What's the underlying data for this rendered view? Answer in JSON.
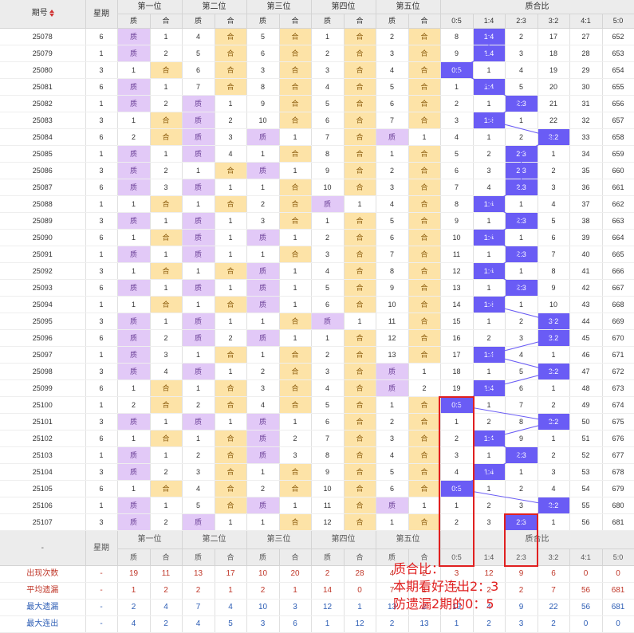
{
  "header": {
    "issue": "期号",
    "week": "星期",
    "positions": [
      "第一位",
      "第二位",
      "第三位",
      "第四位",
      "第五位"
    ],
    "ratio_group": "质合比",
    "sub_zhi": "质",
    "sub_he": "合",
    "ratios": [
      "0:5",
      "1:4",
      "2:3",
      "3:2",
      "4:1",
      "5:0"
    ]
  },
  "colors": {
    "zhi": "#e2c9f7",
    "he": "#fde3a7",
    "hit": "#6a5cf5",
    "annot": "#e02020"
  },
  "rows": [
    {
      "issue": "25078",
      "week": "6",
      "pos": [
        [
          "Z",
          "1"
        ],
        [
          "4",
          "H"
        ],
        [
          "5",
          "H"
        ],
        [
          "1",
          "H"
        ],
        [
          "2",
          "H"
        ]
      ],
      "ratio": [
        "8",
        "1:4",
        "2",
        "17",
        "27",
        "652"
      ],
      "hit": 1
    },
    {
      "issue": "25079",
      "week": "1",
      "pos": [
        [
          "Z",
          "2"
        ],
        [
          "5",
          "H"
        ],
        [
          "6",
          "H"
        ],
        [
          "2",
          "H"
        ],
        [
          "3",
          "H"
        ]
      ],
      "ratio": [
        "9",
        "1:4",
        "3",
        "18",
        "28",
        "653"
      ],
      "hit": 1
    },
    {
      "issue": "25080",
      "week": "3",
      "pos": [
        [
          "1",
          "H"
        ],
        [
          "6",
          "H"
        ],
        [
          "3",
          "H"
        ],
        [
          "3",
          "H"
        ],
        [
          "4",
          "H"
        ]
      ],
      "ratio": [
        "0:5",
        "1",
        "4",
        "19",
        "29",
        "654"
      ],
      "hit": 0
    },
    {
      "issue": "25081",
      "week": "6",
      "pos": [
        [
          "Z",
          "1"
        ],
        [
          "7",
          "H"
        ],
        [
          "8",
          "H"
        ],
        [
          "4",
          "H"
        ],
        [
          "5",
          "H"
        ]
      ],
      "ratio": [
        "1",
        "1:4",
        "5",
        "20",
        "30",
        "655"
      ],
      "hit": 1
    },
    {
      "issue": "25082",
      "week": "1",
      "pos": [
        [
          "Z",
          "2"
        ],
        [
          "Z",
          "1"
        ],
        [
          "9",
          "H"
        ],
        [
          "5",
          "H"
        ],
        [
          "6",
          "H"
        ]
      ],
      "ratio": [
        "2",
        "1",
        "2:3",
        "21",
        "31",
        "656"
      ],
      "hit": 2
    },
    {
      "issue": "25083",
      "week": "3",
      "pos": [
        [
          "1",
          "H"
        ],
        [
          "Z",
          "2"
        ],
        [
          "10",
          "H"
        ],
        [
          "6",
          "H"
        ],
        [
          "7",
          "H"
        ]
      ],
      "ratio": [
        "3",
        "1:4",
        "1",
        "22",
        "32",
        "657"
      ],
      "hit": 1
    },
    {
      "issue": "25084",
      "week": "6",
      "pos": [
        [
          "2",
          "H"
        ],
        [
          "Z",
          "3"
        ],
        [
          "Z",
          "1"
        ],
        [
          "7",
          "H"
        ],
        [
          "Z",
          "1"
        ]
      ],
      "ratio": [
        "4",
        "1",
        "2",
        "3:2",
        "33",
        "658"
      ],
      "hit": 3
    },
    {
      "issue": "25085",
      "week": "1",
      "pos": [
        [
          "Z",
          "1"
        ],
        [
          "Z",
          "4"
        ],
        [
          "1",
          "H"
        ],
        [
          "8",
          "H"
        ],
        [
          "1",
          "H"
        ]
      ],
      "ratio": [
        "5",
        "2",
        "2:3",
        "1",
        "34",
        "659"
      ],
      "hit": 2
    },
    {
      "issue": "25086",
      "week": "3",
      "pos": [
        [
          "Z",
          "2"
        ],
        [
          "1",
          "H"
        ],
        [
          "Z",
          "1"
        ],
        [
          "9",
          "H"
        ],
        [
          "2",
          "H"
        ]
      ],
      "ratio": [
        "6",
        "3",
        "2:3",
        "2",
        "35",
        "660"
      ],
      "hit": 2
    },
    {
      "issue": "25087",
      "week": "6",
      "pos": [
        [
          "Z",
          "3"
        ],
        [
          "Z",
          "1"
        ],
        [
          "1",
          "H"
        ],
        [
          "10",
          "H"
        ],
        [
          "3",
          "H"
        ]
      ],
      "ratio": [
        "7",
        "4",
        "2:3",
        "3",
        "36",
        "661"
      ],
      "hit": 2
    },
    {
      "issue": "25088",
      "week": "1",
      "pos": [
        [
          "1",
          "H"
        ],
        [
          "1",
          "H"
        ],
        [
          "2",
          "H"
        ],
        [
          "Z",
          "1"
        ],
        [
          "4",
          "H"
        ]
      ],
      "ratio": [
        "8",
        "1:4",
        "1",
        "4",
        "37",
        "662"
      ],
      "hit": 1
    },
    {
      "issue": "25089",
      "week": "3",
      "pos": [
        [
          "Z",
          "1"
        ],
        [
          "Z",
          "1"
        ],
        [
          "3",
          "H"
        ],
        [
          "1",
          "H"
        ],
        [
          "5",
          "H"
        ]
      ],
      "ratio": [
        "9",
        "1",
        "2:3",
        "5",
        "38",
        "663"
      ],
      "hit": 2
    },
    {
      "issue": "25090",
      "week": "6",
      "pos": [
        [
          "1",
          "H"
        ],
        [
          "Z",
          "1"
        ],
        [
          "Z",
          "1"
        ],
        [
          "2",
          "H"
        ],
        [
          "6",
          "H"
        ]
      ],
      "ratio": [
        "10",
        "1:4",
        "1",
        "6",
        "39",
        "664"
      ],
      "hit": 1
    },
    {
      "issue": "25091",
      "week": "1",
      "pos": [
        [
          "Z",
          "1"
        ],
        [
          "Z",
          "1"
        ],
        [
          "1",
          "H"
        ],
        [
          "3",
          "H"
        ],
        [
          "7",
          "H"
        ]
      ],
      "ratio": [
        "11",
        "1",
        "2:3",
        "7",
        "40",
        "665"
      ],
      "hit": 2
    },
    {
      "issue": "25092",
      "week": "3",
      "pos": [
        [
          "1",
          "H"
        ],
        [
          "1",
          "H"
        ],
        [
          "Z",
          "1"
        ],
        [
          "4",
          "H"
        ],
        [
          "8",
          "H"
        ]
      ],
      "ratio": [
        "12",
        "1:4",
        "1",
        "8",
        "41",
        "666"
      ],
      "hit": 1
    },
    {
      "issue": "25093",
      "week": "6",
      "pos": [
        [
          "Z",
          "1"
        ],
        [
          "Z",
          "1"
        ],
        [
          "Z",
          "1"
        ],
        [
          "5",
          "H"
        ],
        [
          "9",
          "H"
        ]
      ],
      "ratio": [
        "13",
        "1",
        "2:3",
        "9",
        "42",
        "667"
      ],
      "hit": 2
    },
    {
      "issue": "25094",
      "week": "1",
      "pos": [
        [
          "1",
          "H"
        ],
        [
          "1",
          "H"
        ],
        [
          "Z",
          "1"
        ],
        [
          "6",
          "H"
        ],
        [
          "10",
          "H"
        ]
      ],
      "ratio": [
        "14",
        "1:4",
        "1",
        "10",
        "43",
        "668"
      ],
      "hit": 1
    },
    {
      "issue": "25095",
      "week": "3",
      "pos": [
        [
          "Z",
          "1"
        ],
        [
          "Z",
          "1"
        ],
        [
          "1",
          "H"
        ],
        [
          "Z",
          "1"
        ],
        [
          "11",
          "H"
        ]
      ],
      "ratio": [
        "15",
        "1",
        "2",
        "3:2",
        "44",
        "669"
      ],
      "hit": 3
    },
    {
      "issue": "25096",
      "week": "6",
      "pos": [
        [
          "Z",
          "2"
        ],
        [
          "Z",
          "2"
        ],
        [
          "Z",
          "1"
        ],
        [
          "1",
          "H"
        ],
        [
          "12",
          "H"
        ]
      ],
      "ratio": [
        "16",
        "2",
        "3",
        "3:2",
        "45",
        "670"
      ],
      "hit": 3
    },
    {
      "issue": "25097",
      "week": "1",
      "pos": [
        [
          "Z",
          "3"
        ],
        [
          "1",
          "H"
        ],
        [
          "1",
          "H"
        ],
        [
          "2",
          "H"
        ],
        [
          "13",
          "H"
        ]
      ],
      "ratio": [
        "17",
        "1:4",
        "4",
        "1",
        "46",
        "671"
      ],
      "hit": 1
    },
    {
      "issue": "25098",
      "week": "3",
      "pos": [
        [
          "Z",
          "4"
        ],
        [
          "Z",
          "1"
        ],
        [
          "2",
          "H"
        ],
        [
          "3",
          "H"
        ],
        [
          "Z",
          "1"
        ]
      ],
      "ratio": [
        "18",
        "1",
        "5",
        "3:2",
        "47",
        "672"
      ],
      "hit": 3
    },
    {
      "issue": "25099",
      "week": "6",
      "pos": [
        [
          "1",
          "H"
        ],
        [
          "1",
          "H"
        ],
        [
          "3",
          "H"
        ],
        [
          "4",
          "H"
        ],
        [
          "Z",
          "2"
        ]
      ],
      "ratio": [
        "19",
        "1:4",
        "6",
        "1",
        "48",
        "673"
      ],
      "hit": 1
    },
    {
      "issue": "25100",
      "week": "1",
      "pos": [
        [
          "2",
          "H"
        ],
        [
          "2",
          "H"
        ],
        [
          "4",
          "H"
        ],
        [
          "5",
          "H"
        ],
        [
          "1",
          "H"
        ]
      ],
      "ratio": [
        "0:5",
        "1",
        "7",
        "2",
        "49",
        "674"
      ],
      "hit": 0
    },
    {
      "issue": "25101",
      "week": "3",
      "pos": [
        [
          "Z",
          "1"
        ],
        [
          "Z",
          "1"
        ],
        [
          "Z",
          "1"
        ],
        [
          "6",
          "H"
        ],
        [
          "2",
          "H"
        ]
      ],
      "ratio": [
        "1",
        "2",
        "8",
        "3:2",
        "50",
        "675"
      ],
      "hit": 3
    },
    {
      "issue": "25102",
      "week": "6",
      "pos": [
        [
          "1",
          "H"
        ],
        [
          "1",
          "H"
        ],
        [
          "Z",
          "2"
        ],
        [
          "7",
          "H"
        ],
        [
          "3",
          "H"
        ]
      ],
      "ratio": [
        "2",
        "1:4",
        "9",
        "1",
        "51",
        "676"
      ],
      "hit": 1
    },
    {
      "issue": "25103",
      "week": "1",
      "pos": [
        [
          "Z",
          "1"
        ],
        [
          "2",
          "H"
        ],
        [
          "Z",
          "3"
        ],
        [
          "8",
          "H"
        ],
        [
          "4",
          "H"
        ]
      ],
      "ratio": [
        "3",
        "1",
        "2:3",
        "2",
        "52",
        "677"
      ],
      "hit": 2
    },
    {
      "issue": "25104",
      "week": "3",
      "pos": [
        [
          "Z",
          "2"
        ],
        [
          "3",
          "H"
        ],
        [
          "1",
          "H"
        ],
        [
          "9",
          "H"
        ],
        [
          "5",
          "H"
        ]
      ],
      "ratio": [
        "4",
        "1:4",
        "1",
        "3",
        "53",
        "678"
      ],
      "hit": 1
    },
    {
      "issue": "25105",
      "week": "6",
      "pos": [
        [
          "1",
          "H"
        ],
        [
          "4",
          "H"
        ],
        [
          "2",
          "H"
        ],
        [
          "10",
          "H"
        ],
        [
          "6",
          "H"
        ]
      ],
      "ratio": [
        "0:5",
        "1",
        "2",
        "4",
        "54",
        "679"
      ],
      "hit": 0
    },
    {
      "issue": "25106",
      "week": "1",
      "pos": [
        [
          "Z",
          "1"
        ],
        [
          "5",
          "H"
        ],
        [
          "Z",
          "1"
        ],
        [
          "11",
          "H"
        ],
        [
          "Z",
          "1"
        ]
      ],
      "ratio": [
        "1",
        "2",
        "3",
        "3:2",
        "55",
        "680"
      ],
      "hit": 3
    },
    {
      "issue": "25107",
      "week": "3",
      "pos": [
        [
          "Z",
          "2"
        ],
        [
          "Z",
          "1"
        ],
        [
          "1",
          "H"
        ],
        [
          "12",
          "H"
        ],
        [
          "1",
          "H"
        ]
      ],
      "ratio": [
        "2",
        "3",
        "2:3",
        "1",
        "56",
        "681"
      ],
      "hit": 2
    }
  ],
  "footer": {
    "dash": "-",
    "week": "星期"
  },
  "stats": [
    {
      "label": "出现次数",
      "cls": "red",
      "week": "-",
      "vals": [
        "19",
        "11",
        "13",
        "17",
        "10",
        "20",
        "2",
        "28",
        "4",
        "2",
        "3",
        "12",
        "9",
        "6",
        "0",
        "0"
      ]
    },
    {
      "label": "平均遗漏",
      "cls": "red",
      "week": "-",
      "vals": [
        "1",
        "2",
        "2",
        "1",
        "2",
        "1",
        "14",
        "0",
        "7",
        "1",
        "7",
        "2",
        "2",
        "7",
        "56",
        "681"
      ]
    },
    {
      "label": "最大遗漏",
      "cls": "blue",
      "week": "-",
      "vals": [
        "2",
        "4",
        "7",
        "4",
        "10",
        "3",
        "12",
        "1",
        "13",
        "2",
        "19",
        "4",
        "9",
        "22",
        "56",
        "681"
      ]
    },
    {
      "label": "最大连出",
      "cls": "blue",
      "week": "-",
      "vals": [
        "4",
        "2",
        "4",
        "5",
        "3",
        "6",
        "1",
        "12",
        "2",
        "13",
        "1",
        "2",
        "3",
        "2",
        "0",
        "0"
      ]
    }
  ],
  "annotation": {
    "line1": "质合比：",
    "line2": "本期看好连出2：3",
    "line3": "防遗漏2期的0：5"
  }
}
